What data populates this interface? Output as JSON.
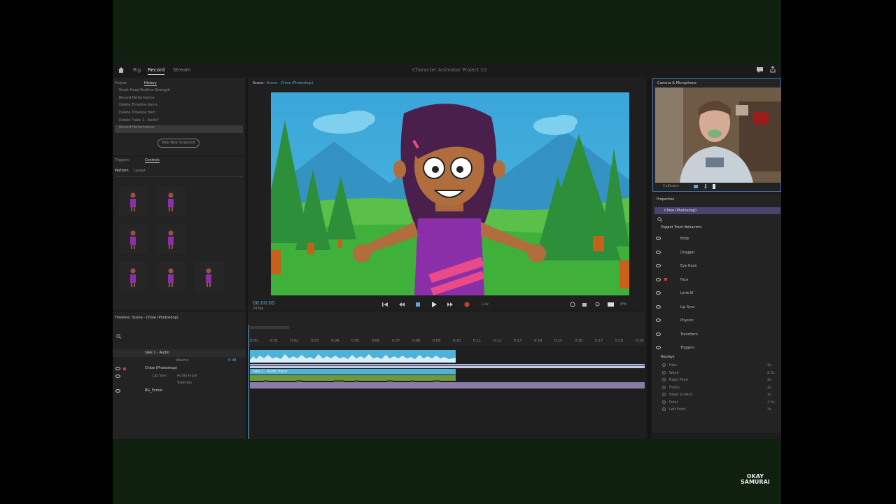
{
  "workspace_tabs": [
    "Rig",
    "Record",
    "Stream"
  ],
  "active_workspace": "Record",
  "project_title": "Character Animator Project 10",
  "left_panel": {
    "tabs": [
      "Project",
      "History"
    ],
    "history_items": [
      "Reset Head Position Strength",
      "Record Performance",
      "Delete Timeline Items",
      "Delete Timeline Item",
      "Delete \"take 1 - Audio\"",
      "Record Performance"
    ],
    "new_snapshot_button": "Take New Snapshot"
  },
  "triggers_panel": {
    "tabs": [
      "Triggers",
      "Controls"
    ],
    "sub_tabs": [
      "Perform",
      "Layout"
    ]
  },
  "scene": {
    "label": "Scene:",
    "name": "Scene - Chloe (Photoshop)",
    "timecode": "00:00:00",
    "fps": "24 fps",
    "speed": "1.0x",
    "zoom": "(Fit)"
  },
  "camera_panel": {
    "title": "Camera & Microphone",
    "calibrate_label": "Calibrate"
  },
  "properties_panel": {
    "title": "Properties",
    "puppet_name": "Chloe (Photoshop)",
    "section_title": "Puppet Track Behaviors",
    "behaviors": [
      "Body",
      "Dragger",
      "Eye Gaze",
      "Face",
      "Limb IK",
      "Lip Sync",
      "Physics",
      "Transform",
      "Triggers"
    ],
    "replays_title": "Replays",
    "replays": [
      {
        "name": "Hips",
        "key": "2s"
      },
      {
        "name": "Wave",
        "key": "2.3s"
      },
      {
        "name": "Right Point",
        "key": "2s"
      },
      {
        "name": "Fistful",
        "key": "2s"
      },
      {
        "name": "Head Scratch",
        "key": "2s"
      },
      {
        "name": "Point",
        "key": "2.3s"
      },
      {
        "name": "Left Point",
        "key": "2s"
      }
    ]
  },
  "timeline": {
    "title": "Timeline: Scene - Chloe (Photoshop)",
    "tracks": [
      {
        "name": "take 1 - Audio",
        "sub": "Volume",
        "value": "0 dB"
      },
      {
        "name": "Chloe (Photoshop)",
        "sub": "Lip Sync",
        "value": "Audio Input"
      },
      {
        "name": "",
        "sub": "",
        "value": "Visemes"
      },
      {
        "name": "BG_Forest",
        "sub": "",
        "value": ""
      }
    ],
    "clip_label": "take 1 - Audio Input",
    "ruler_labels": [
      "0:00",
      "0:01",
      "0:02",
      "0:03",
      "0:04",
      "0:05",
      "0:06",
      "0:07",
      "0:08",
      "0:09",
      "0:10",
      "0:11",
      "0:12",
      "0:13",
      "0:14",
      "0:15",
      "0:16",
      "0:17",
      "0:18",
      "0:19"
    ]
  },
  "watermark": {
    "line1": "OKAY",
    "line2": "SAMURAI"
  },
  "colors": {
    "accent_blue": "#5fa8d8",
    "audio_clip": "#4fb3d9",
    "puppet_track": "#8a7aa6",
    "record_red": "#d13b3b",
    "selection_purple": "#4d4170"
  }
}
